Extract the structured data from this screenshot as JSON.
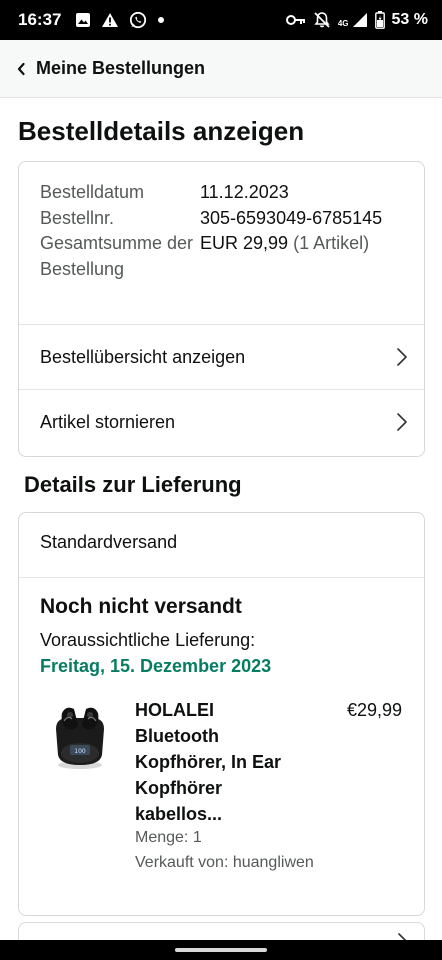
{
  "status_bar": {
    "time": "16:37",
    "network": "4G",
    "battery": "53 %",
    "icons_left": [
      "image-icon",
      "warning-icon",
      "whatsapp-icon",
      "dot-icon"
    ],
    "icons_right": [
      "key-icon",
      "muted-bell-icon",
      "signal-icon",
      "battery-icon"
    ]
  },
  "header": {
    "back_label": "Meine Bestellungen"
  },
  "page": {
    "title": "Bestelldetails anzeigen"
  },
  "order_summary": {
    "date_label": "Bestelldatum",
    "date_value": "11.12.2023",
    "number_label": "Bestellnr.",
    "number_value": "305-6593049-6785145",
    "total_label": "Gesamtsumme der Bestellung",
    "total_value": "EUR 29,99",
    "total_items": "(1 Artikel)",
    "links": [
      "Bestellübersicht anzeigen",
      "Artikel stornieren"
    ]
  },
  "delivery": {
    "section_title": "Details zur Lieferung",
    "shipping_type": "Standardversand",
    "status": "Noch nicht versandt",
    "eta_label": "Voraussichtliche Lieferung:",
    "eta_date": "Freitag, 15. Dezember 2023",
    "status_color": "#067d62",
    "product": {
      "name": "HOLALEI Bluetooth Kopfhörer, In Ear Kopfhörer kabellos...",
      "price": "€29,99",
      "quantity": "Menge: 1",
      "seller": "Verkauft von: huangliwen"
    }
  },
  "colors": {
    "accent_green": "#067d62",
    "text": "#0f1111",
    "muted": "#565959",
    "border": "#d5d9d9"
  }
}
